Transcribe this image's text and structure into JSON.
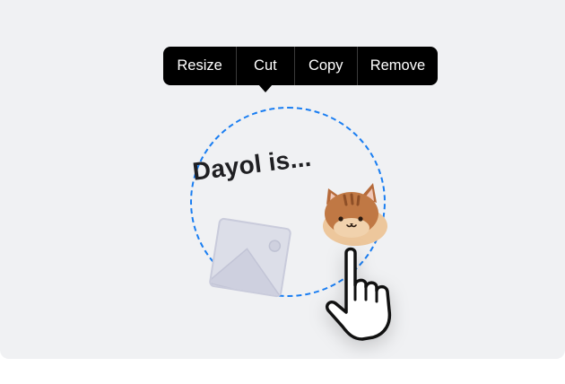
{
  "context_menu": {
    "items": [
      "Resize",
      "Cut",
      "Copy",
      "Remove"
    ]
  },
  "canvas": {
    "text_sticker": "Dayol is...",
    "selection_color": "#1a7ef2",
    "background": "#f0f1f3"
  },
  "icons": {
    "image": "image-placeholder-icon",
    "cat": "cat-sticker",
    "pointer": "hand-pointer-icon"
  }
}
